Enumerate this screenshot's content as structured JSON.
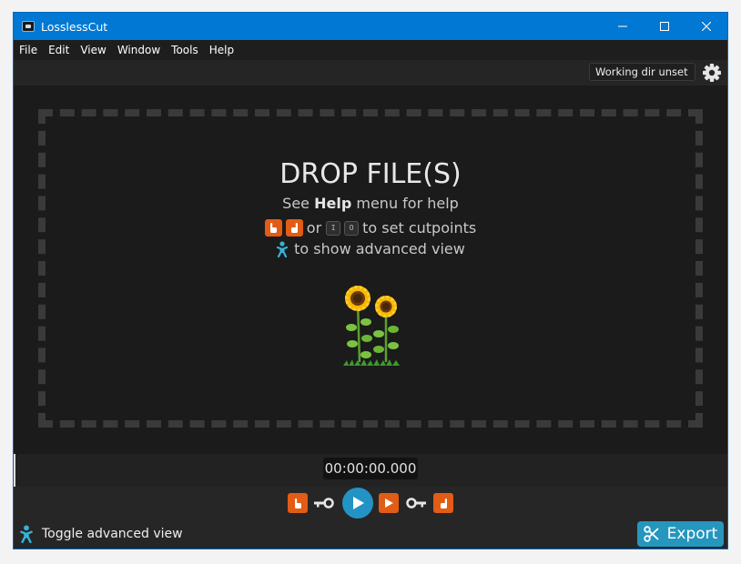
{
  "window": {
    "title": "LosslessCut"
  },
  "menu": [
    "File",
    "Edit",
    "View",
    "Window",
    "Tools",
    "Help"
  ],
  "topbar": {
    "working_dir": "Working dir unset"
  },
  "drop": {
    "title": "DROP FILE(S)",
    "help_prefix": "See ",
    "help_bold": "Help",
    "help_suffix": " menu for help",
    "or_text": "or",
    "key_in": "I",
    "key_out": "O",
    "cutpoints_text": "to set cutpoints",
    "advanced_text": "to show advanced view"
  },
  "timeline": {
    "timecode": "00:00:00.000"
  },
  "bottom": {
    "toggle_label": "Toggle advanced view",
    "export_label": "Export"
  },
  "colors": {
    "accent": "#2596be",
    "titlebar": "#0078d4",
    "cut_button": "#e25c16",
    "background": "#1b1b1b"
  },
  "icons": [
    "settings-gear-icon",
    "hand-point-left-icon",
    "hand-point-right-icon",
    "key-icon",
    "play-icon",
    "step-icon",
    "baby-icon",
    "scissors-icon",
    "sunflower-icon"
  ]
}
